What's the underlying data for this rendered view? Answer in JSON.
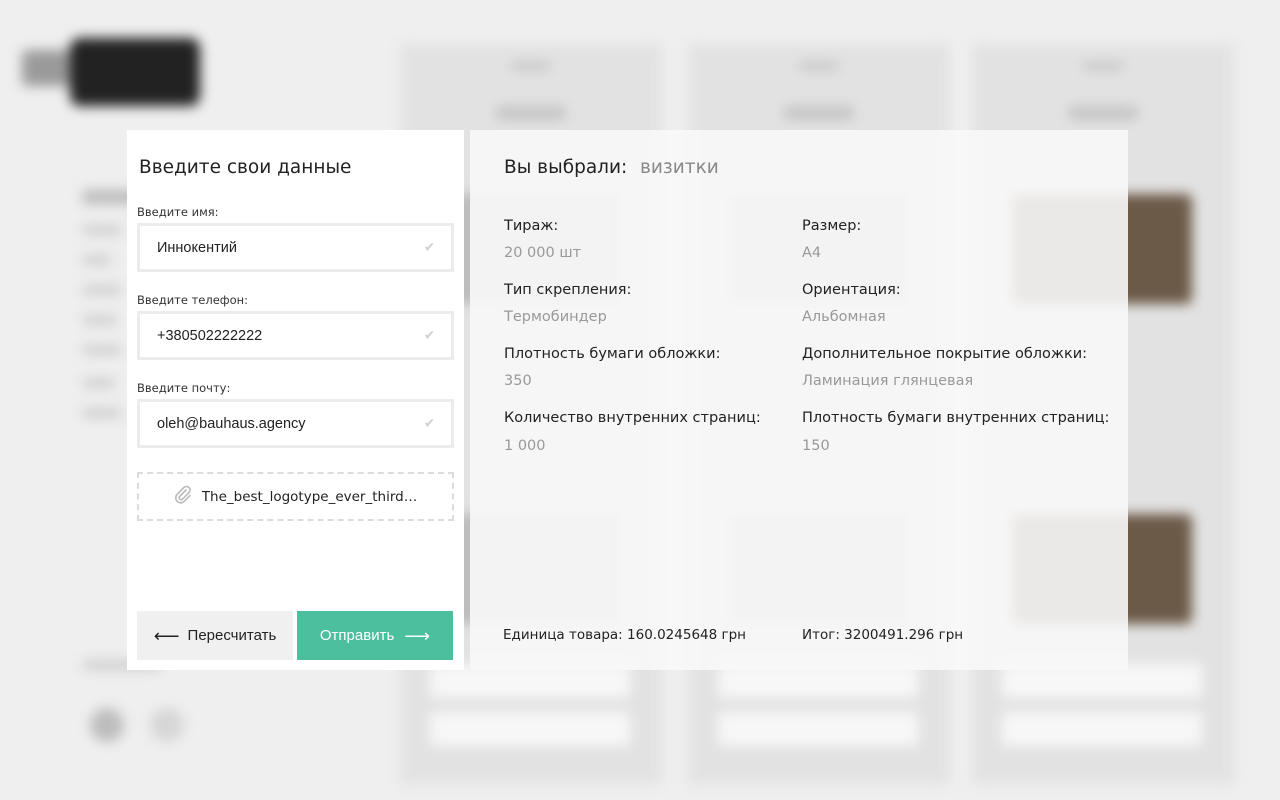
{
  "form": {
    "title": "Введите свои данные",
    "name_label": "Введите имя:",
    "name_value": "Иннокентий",
    "phone_label": "Введите телефон:",
    "phone_value": "+380502222222",
    "email_label": "Введите почту:",
    "email_value": "oleh@bauhaus.agency",
    "attachment_name": "The_best_logotype_ever_third…",
    "recalc_label": "Пересчитать",
    "send_label": "Отправить",
    "accent_color": "#4cbf9e"
  },
  "summary": {
    "title": "Вы выбрали:",
    "choice": "визитки",
    "specs": [
      {
        "label": "Тираж:",
        "value": "20 000 шт"
      },
      {
        "label": "Размер:",
        "value": "A4"
      },
      {
        "label": "Тип скрепления:",
        "value": "Термобиндер"
      },
      {
        "label": "Ориентация:",
        "value": "Альбомная"
      },
      {
        "label": "Плотность бумаги обложки:",
        "value": "350"
      },
      {
        "label": "Дополнительное покрытие обложки:",
        "value": "Ламинация глянцевая"
      },
      {
        "label": "Количество внутренних страниц:",
        "value": "1 000"
      },
      {
        "label": "Плотность бумаги внутренних страниц:",
        "value": "150"
      }
    ],
    "unit_price": "Единица товара: 160.0245648 грн",
    "total_price": "Итог: 3200491.296 грн"
  },
  "icons": {
    "check": "check-icon",
    "attach": "paperclip-icon",
    "arrow_left": "arrow-left-icon",
    "arrow_right": "arrow-right-icon"
  }
}
